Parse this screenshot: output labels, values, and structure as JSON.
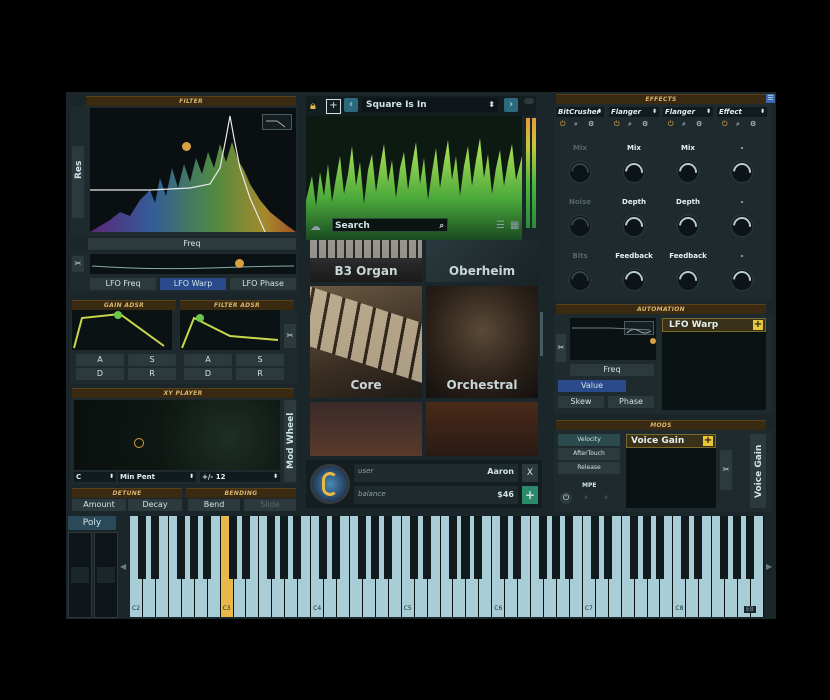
{
  "filter": {
    "header": "FILTER",
    "res_label": "Res",
    "freq_label": "Freq",
    "lfo_buttons": [
      "LFO Freq",
      "LFO Warp",
      "LFO Phase"
    ]
  },
  "gain_adsr": {
    "header": "GAIN ADSR",
    "buttons": [
      "A",
      "S",
      "D",
      "R"
    ]
  },
  "filter_adsr": {
    "header": "FILTER ADSR",
    "buttons": [
      "A",
      "S",
      "D",
      "R"
    ]
  },
  "xy_player": {
    "header": "XY PLAYER",
    "key": "C",
    "scale": "Min Pent",
    "range": "+/- 12",
    "side_label": "Mod Wheel"
  },
  "detune": {
    "header": "DETUNE",
    "buttons": [
      "Amount",
      "Decay"
    ]
  },
  "bending": {
    "header": "BENDING",
    "buttons": [
      "Bend",
      "Slide"
    ]
  },
  "preset": {
    "name": "Square Is In"
  },
  "search": {
    "placeholder": "Search"
  },
  "browser": {
    "tiles": [
      "B3 Organ",
      "Oberheim",
      "Core",
      "Orchestral"
    ]
  },
  "account": {
    "user_label": "user",
    "user_value": "Aaron",
    "balance_label": "balance",
    "balance_value": "$46",
    "close": "X",
    "add": "+"
  },
  "effects": {
    "header": "EFFECTS",
    "slots": [
      {
        "name": "BitCrusher",
        "knobs": [
          "Mix",
          "Noise",
          "Bits"
        ],
        "active": false
      },
      {
        "name": "Flanger",
        "knobs": [
          "Mix",
          "Depth",
          "Feedback"
        ],
        "active": true
      },
      {
        "name": "Flanger",
        "knobs": [
          "Mix",
          "Depth",
          "Feedback"
        ],
        "active": true
      },
      {
        "name": "Effect",
        "knobs": [
          "-",
          "-",
          "-"
        ],
        "active": true
      }
    ]
  },
  "automation": {
    "header": "AUTOMATION",
    "freq_label": "Freq",
    "value_label": "Value",
    "skew_label": "Skew",
    "phase_label": "Phase",
    "target": "LFO Warp"
  },
  "mods": {
    "header": "MODS",
    "sources": [
      "Velocity",
      "AfterTouch",
      "Release"
    ],
    "mpe_label": "MPE",
    "target": "Voice Gain",
    "side_label": "Voice Gain"
  },
  "keyboard": {
    "mode": "Poly",
    "octave_labels": [
      "C2",
      "C3",
      "C4",
      "C5",
      "C6",
      "C7",
      "C8"
    ],
    "active_key": "C3",
    "corner_label": "E8",
    "nav_left": "◀",
    "nav_right": "▶"
  },
  "colors": {
    "accent": "#e8b84a",
    "panel": "#1e2a2d",
    "header": "#3a2a12",
    "selected": "#2a4a8c",
    "key": "#a9cdd6"
  }
}
